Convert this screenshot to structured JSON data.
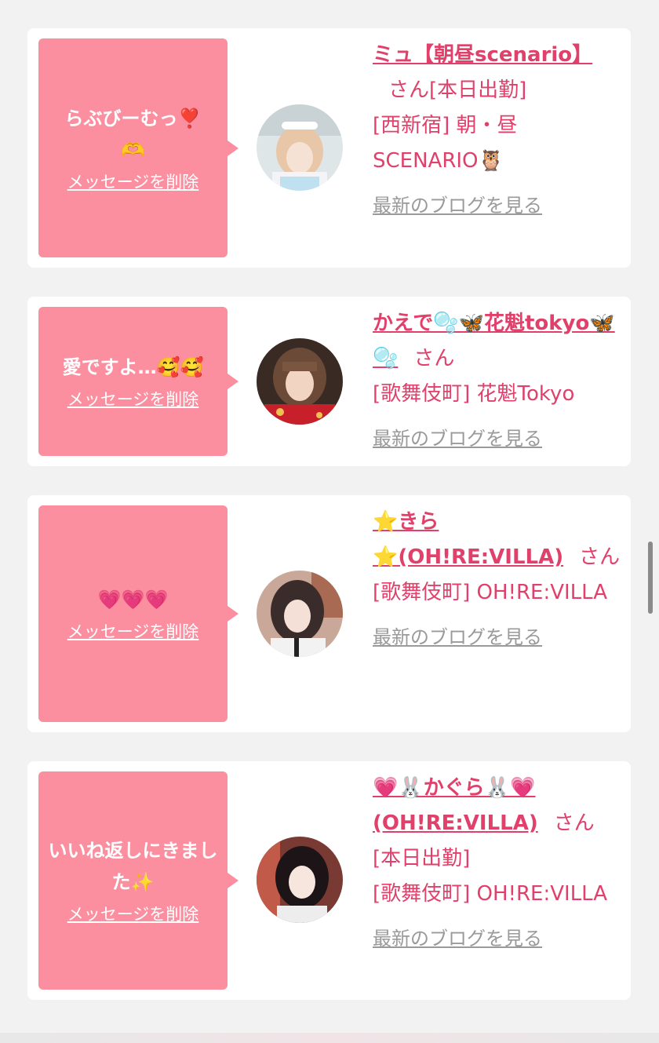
{
  "messages": [
    {
      "message": "らぶびーむっ❣️🫶",
      "delete_label": "メッセージを削除",
      "name_line": "ミュ【朝昼scenario】",
      "san": "さん",
      "status": "[本日出勤]",
      "shop": "[西新宿] 朝・昼SCENARIO🦉",
      "blog_label": "最新のブログを見る",
      "avatar_icon": "avatar-blonde-maid"
    },
    {
      "message": "愛ですよ…🥰🥰",
      "delete_label": "メッセージを削除",
      "name_line": "かえで🫧🦋花魁tokyo🦋🫧",
      "san": "さん",
      "status": "",
      "shop": "[歌舞伎町] 花魁Tokyo",
      "blog_label": "最新のブログを見る",
      "avatar_icon": "avatar-red-kimono"
    },
    {
      "message": "💗💗💗",
      "delete_label": "メッセージを削除",
      "name_line": "⭐️きら⭐️(OH!RE:VILLA)",
      "san": "さん",
      "status": "",
      "shop": "[歌舞伎町] OH!RE:VILLA",
      "blog_label": "最新のブログを見る",
      "avatar_icon": "avatar-dark-hair"
    },
    {
      "message": "いいね返しにきました✨",
      "delete_label": "メッセージを削除",
      "name_line": "💗🐰かぐら🐰💗(OH!RE:VILLA)",
      "san": "さん",
      "status": "[本日出勤]",
      "shop": "[歌舞伎町] OH!RE:VILLA",
      "blog_label": "最新のブログを見る",
      "avatar_icon": "avatar-black-hair"
    }
  ],
  "colors": {
    "bubble": "#fb8fa0",
    "name": "#e0406a",
    "link_gray": "#9a9a9a",
    "background": "#f2f2f2"
  }
}
